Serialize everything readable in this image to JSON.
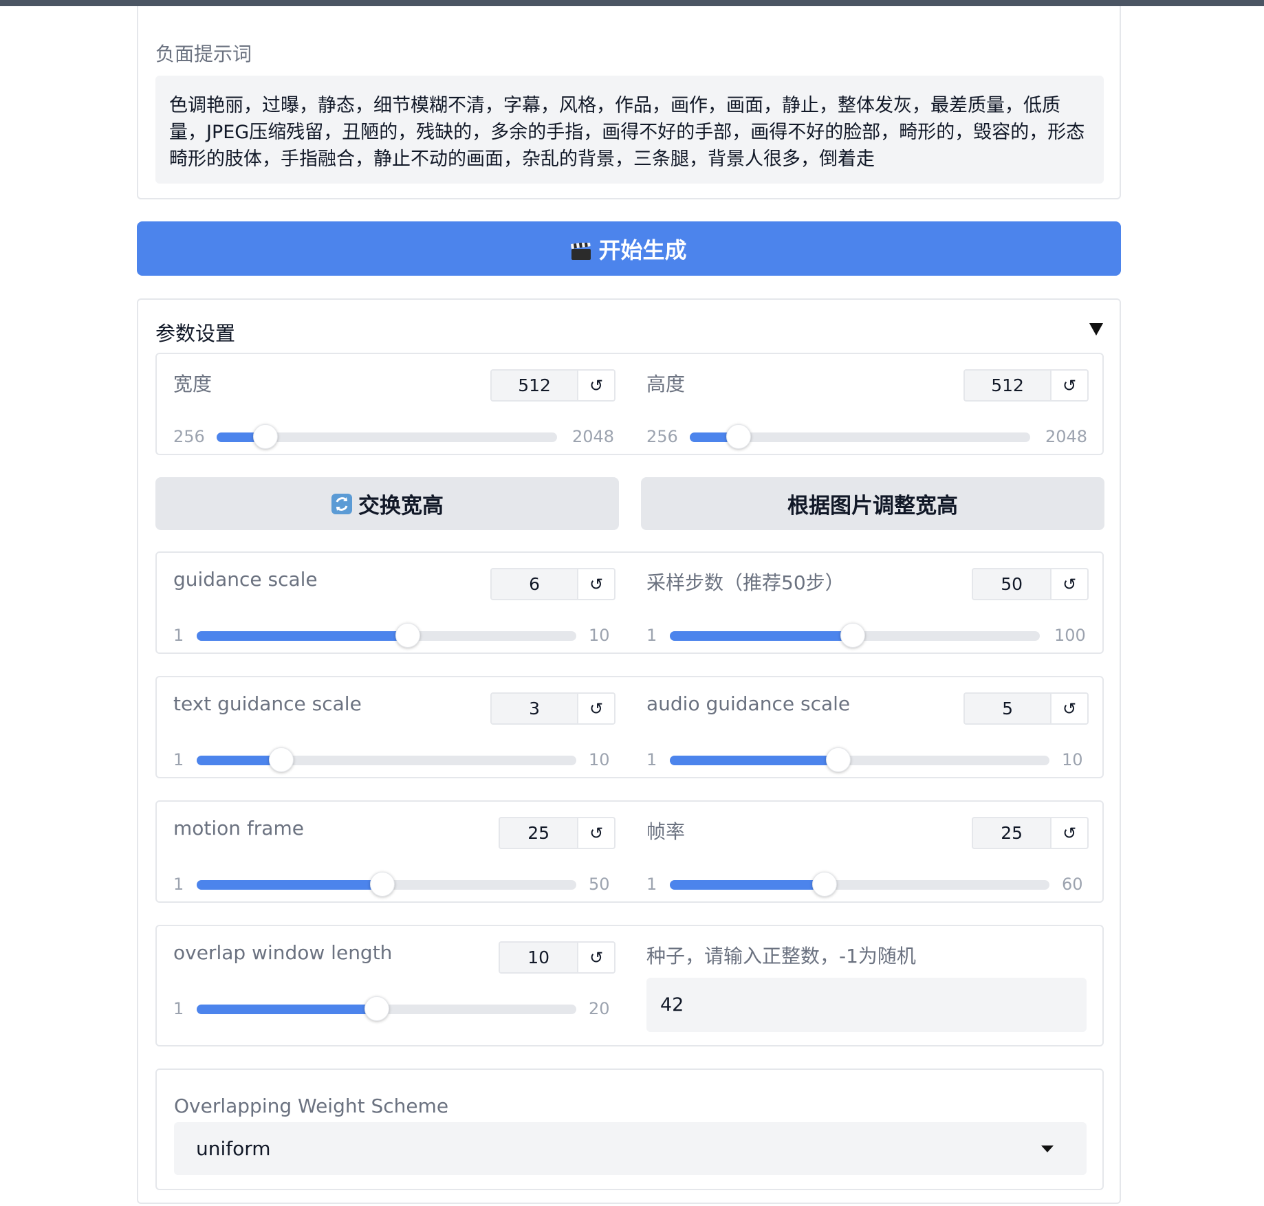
{
  "negative_prompt": {
    "label": "负面提示词",
    "text": "色调艳丽，过曝，静态，细节模糊不清，字幕，风格，作品，画作，画面，静止，整体发灰，最差质量，低质量，JPEG压缩残留，丑陋的，残缺的，多余的手指，画得不好的手部，画得不好的脸部，畸形的，毁容的，形态畸形的肢体，手指融合，静止不动的画面，杂乱的背景，三条腿，背景人很多，倒着走"
  },
  "generate_button": {
    "icon": "clapper-board-icon",
    "label": "开始生成",
    "color": "#4c84ec"
  },
  "params": {
    "title": "参数设置",
    "width": {
      "label": "宽度",
      "value": "512",
      "min": "256",
      "max": "2048",
      "level": 0.143
    },
    "height": {
      "label": "高度",
      "value": "512",
      "min": "256",
      "max": "2048",
      "level": 0.143
    },
    "swap_button": {
      "icon": "swap-arrows-icon",
      "label": "交换宽高"
    },
    "resize_button": {
      "label": "根据图片调整宽高"
    },
    "guidance_scale": {
      "label": "guidance scale",
      "value": "6",
      "min": "1",
      "max": "10",
      "level": 0.556
    },
    "sample_steps": {
      "label": "采样步数（推荐50步）",
      "value": "50",
      "min": "1",
      "max": "100",
      "level": 0.495
    },
    "text_guidance_scale": {
      "label": "text guidance scale",
      "value": "3",
      "min": "1",
      "max": "10",
      "level": 0.222
    },
    "audio_guidance_scale": {
      "label": "audio guidance scale",
      "value": "5",
      "min": "1",
      "max": "10",
      "level": 0.444
    },
    "motion_frame": {
      "label": "motion frame",
      "value": "25",
      "min": "1",
      "max": "50",
      "level": 0.49
    },
    "fps": {
      "label": "帧率",
      "value": "25",
      "min": "1",
      "max": "60",
      "level": 0.407
    },
    "overlap_window_length": {
      "label": "overlap window length",
      "value": "10",
      "min": "1",
      "max": "20",
      "level": 0.474
    },
    "seed": {
      "label": "种子，请输入正整数，-1为随机",
      "value": "42"
    },
    "weight_scheme": {
      "label": "Overlapping Weight Scheme",
      "value": "uniform"
    }
  },
  "colors": {
    "accent": "#4c84ec",
    "track": "#e5e7eb",
    "input_bg": "#f3f4f6",
    "topbar": "#4b5563"
  }
}
